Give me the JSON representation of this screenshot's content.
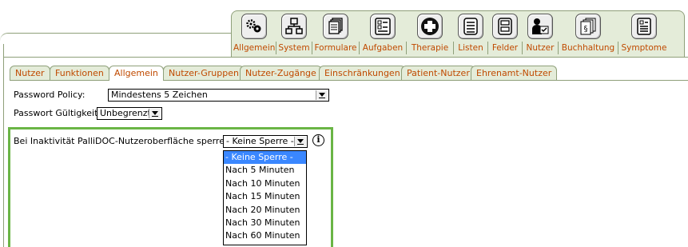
{
  "toolbar": {
    "items": [
      {
        "label": "Allgemein",
        "icon": "gears-icon"
      },
      {
        "label": "System",
        "icon": "network-icon"
      },
      {
        "label": "Formulare",
        "icon": "forms-icon"
      },
      {
        "label": "Aufgaben",
        "icon": "checklist-icon"
      },
      {
        "label": "Therapie",
        "icon": "medical-cross-icon"
      },
      {
        "label": "Listen",
        "icon": "list-icon"
      },
      {
        "label": "Felder",
        "icon": "fields-icon"
      },
      {
        "label": "Nutzer",
        "icon": "user-icon"
      },
      {
        "label": "Buchhaltung",
        "icon": "paragraph-documents-icon"
      },
      {
        "label": "Symptome",
        "icon": "symptom-checklist-icon"
      }
    ]
  },
  "tabs": [
    {
      "label": "Nutzer",
      "active": false
    },
    {
      "label": "Funktionen",
      "active": false
    },
    {
      "label": "Allgemein",
      "active": true
    },
    {
      "label": "Nutzer-Gruppen",
      "active": false
    },
    {
      "label": "Nutzer-Zugänge",
      "active": false
    },
    {
      "label": "Einschränkungen",
      "active": false
    },
    {
      "label": "Patient-Nutzer",
      "active": false
    },
    {
      "label": "Ehrenamt-Nutzer",
      "active": false
    }
  ],
  "form": {
    "password_policy_label": "Password Policy:",
    "password_policy_value": "Mindestens 5 Zeichen",
    "password_validity_label": "Passwort Gültigkeit:",
    "password_validity_value": "Unbegrenzt",
    "inactivity_label": "Bei Inaktivität PalliDOC-Nutzeroberfläche sperren:",
    "inactivity_value": "- Keine Sperre -",
    "info_icon": "i"
  },
  "inactivity_options": [
    "- Keine Sperre -",
    "Nach 5 Minuten",
    "Nach 10 Minuten",
    "Nach 15 Minuten",
    "Nach 20 Minuten",
    "Nach 30 Minuten",
    "Nach 60 Minuten"
  ],
  "colors": {
    "tab_text": "#c04a00",
    "toolbar_bg": "#e4ecd9",
    "frame_border": "#8fa07a",
    "highlight_box": "#6ab545",
    "dropdown_selected": "#3a87ff"
  }
}
